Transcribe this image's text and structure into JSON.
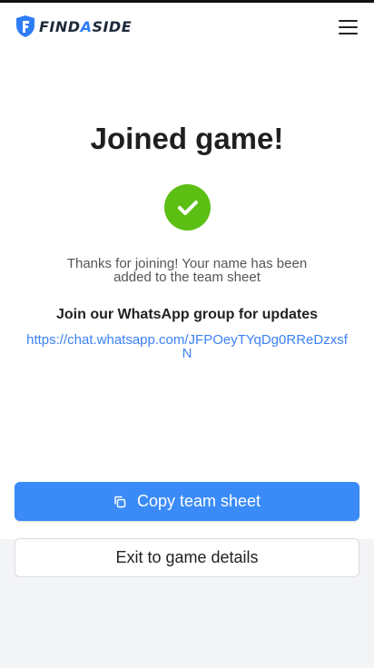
{
  "header": {
    "logo_text_pre": "FIND",
    "logo_text_accent": "A",
    "logo_text_post": "SIDE",
    "menu_icon": "hamburger-menu-icon"
  },
  "main": {
    "title": "Joined game!",
    "status_icon": "check-circle-icon",
    "thanks_message": "Thanks for joining! Your name has been added to the team sheet",
    "whatsapp_heading": "Join our WhatsApp group for updates",
    "whatsapp_link": "https://chat.whatsapp.com/JFPOeyTYqDg0RReDzxsfN"
  },
  "actions": {
    "copy_label": "Copy team sheet",
    "copy_icon": "copy-icon",
    "exit_label": "Exit to game details"
  },
  "colors": {
    "accent": "#3a8bf7",
    "success": "#5cbf14",
    "link": "#3b82f6"
  }
}
